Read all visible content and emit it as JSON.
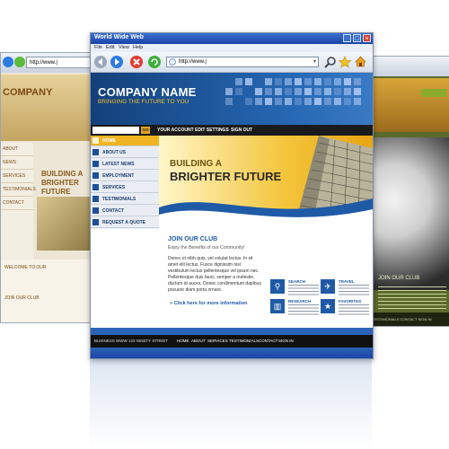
{
  "colors": {
    "header_blue": "#1d4f9a",
    "accent_gold": "#f0b423",
    "nav_black": "#1a1a1a",
    "link_blue": "#1f5aa6"
  },
  "window": {
    "title": "World Wide Web",
    "menu": [
      "File",
      "Edit",
      "View",
      "Help"
    ],
    "controls": [
      "_",
      "□",
      "×"
    ]
  },
  "toolbar": {
    "back_icon": "left-arrow",
    "forward_icon": "right-arrow",
    "stop_icon": "x",
    "refresh_icon": "circular-arrows",
    "url": "http://www.|",
    "search_icon": "magnifier",
    "bookmark_icon": "star",
    "home_icon": "house"
  },
  "header": {
    "company_name": "COMPANY NAME",
    "tagline": "BRINGING THE FUTURE TO YOU"
  },
  "navstrip": {
    "go_label": "GO",
    "links": [
      "YOUR ACCOUNT",
      "EDIT SETTINGS",
      "SIGN OUT"
    ]
  },
  "sidebar": {
    "items": [
      {
        "label": "HOME"
      },
      {
        "label": "ABOUT US"
      },
      {
        "label": "LATEST NEWS"
      },
      {
        "label": "EMPLOYMENT"
      },
      {
        "label": "SERVICES"
      },
      {
        "label": "TESTIMONIALS"
      },
      {
        "label": "CONTACT"
      },
      {
        "label": "REQUEST A QUOTE"
      }
    ]
  },
  "hero": {
    "line1": "BUILDING A",
    "line2": "BRIGHTER FUTURE"
  },
  "club": {
    "title": "JOIN OUR CLUB",
    "subtitle": "Enjoy the Benefits of our Community!",
    "body": "Donec et nibh quis, vel volutat lectus. In sit amet elit lectus. Fusce dignissim nisl vestibulum lectus pellentesque vel ipsum nec. Pellentesque duis fauci, semper a molestie, ductum id auces. Donec condimentum dapibus posuere diam porta ornare.",
    "link": "» Click here for more information"
  },
  "features": [
    {
      "title": "SEARCH",
      "icon": "magnifier-icon"
    },
    {
      "title": "TRAVEL",
      "icon": "airplane-icon"
    },
    {
      "title": "RESEARCH",
      "icon": "bar-chart-icon"
    },
    {
      "title": "FAVORITES",
      "icon": "star-icon"
    }
  ],
  "footer": {
    "address": "BUSINESS WWW  123 NINETY STREET",
    "links": [
      "HOME",
      "ABOUT",
      "SERVICES",
      "TESTIMONIALS",
      "CONTACT",
      "SIGN IN"
    ]
  },
  "left_window": {
    "url": "http://www.|",
    "company": "COMPANY",
    "nav": [
      "ABOUT",
      "NEWS",
      "SERVICES",
      "TESTIMONIALS",
      "CONTACT"
    ],
    "hero_line1": "BUILDING A",
    "hero_line2": "BRIGHTER FUTURE",
    "club_title": "JOIN OUR CLUB",
    "welcome": "WELCOME TO OUR"
  },
  "right_window": {
    "club_title": "JOIN OUR CLUB",
    "footer_links": [
      "TESTIMONIALS",
      "CONTACT",
      "SIGN IN"
    ]
  }
}
